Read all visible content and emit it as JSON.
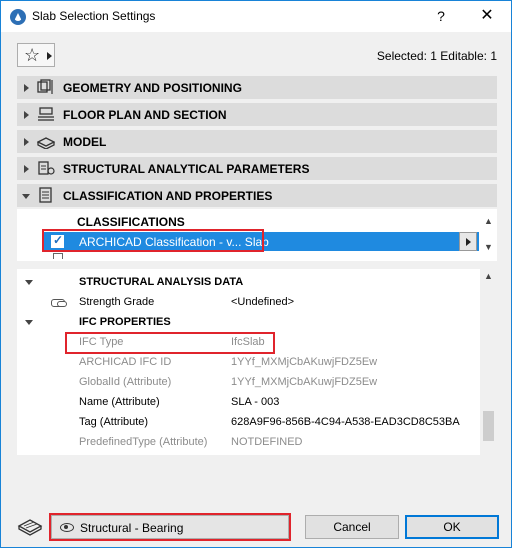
{
  "window": {
    "title": "Slab Selection Settings",
    "help_label": "?",
    "close_label": "✕"
  },
  "toolbar": {
    "favorites_icon": "star-icon",
    "selected_info": "Selected: 1 Editable: 1"
  },
  "sections": [
    {
      "label": "GEOMETRY AND POSITIONING",
      "expanded": false,
      "icon": "geometry-icon"
    },
    {
      "label": "FLOOR PLAN AND SECTION",
      "expanded": false,
      "icon": "floor-plan-icon"
    },
    {
      "label": "MODEL",
      "expanded": false,
      "icon": "model-icon"
    },
    {
      "label": "STRUCTURAL ANALYTICAL PARAMETERS",
      "expanded": false,
      "icon": "structural-icon"
    },
    {
      "label": "CLASSIFICATION AND PROPERTIES",
      "expanded": true,
      "icon": "classification-icon"
    }
  ],
  "classifications": {
    "header": "CLASSIFICATIONS",
    "selected_row": "ARCHICAD Classification - v... Slab",
    "checked": true
  },
  "properties": {
    "structural_group": "STRUCTURAL ANALYSIS DATA",
    "strength_grade": {
      "label": "Strength Grade",
      "value": "<Undefined>"
    },
    "ifc_group": "IFC PROPERTIES",
    "rows": [
      {
        "label": "IFC Type",
        "value": "IfcSlab",
        "enabled": false
      },
      {
        "label": "ARCHICAD IFC ID",
        "value": "1YYf_MXMjCbAKuwjFDZ5Ew",
        "enabled": false
      },
      {
        "label": "GlobalId (Attribute)",
        "value": "1YYf_MXMjCbAKuwjFDZ5Ew",
        "enabled": false
      },
      {
        "label": "Name (Attribute)",
        "value": "SLA - 003",
        "enabled": true
      },
      {
        "label": "Tag (Attribute)",
        "value": "628A9F96-856B-4C94-A538-EAD3CD8C53BA",
        "enabled": true
      },
      {
        "label": "PredefinedType (Attribute)",
        "value": "NOTDEFINED",
        "enabled": false
      }
    ]
  },
  "footer": {
    "layer_select": "Structural - Bearing",
    "cancel_label": "Cancel",
    "ok_label": "OK"
  },
  "colors": {
    "selection": "#1f8ae0",
    "highlight": "#e0242c",
    "section_bg": "#dcdcdc"
  }
}
